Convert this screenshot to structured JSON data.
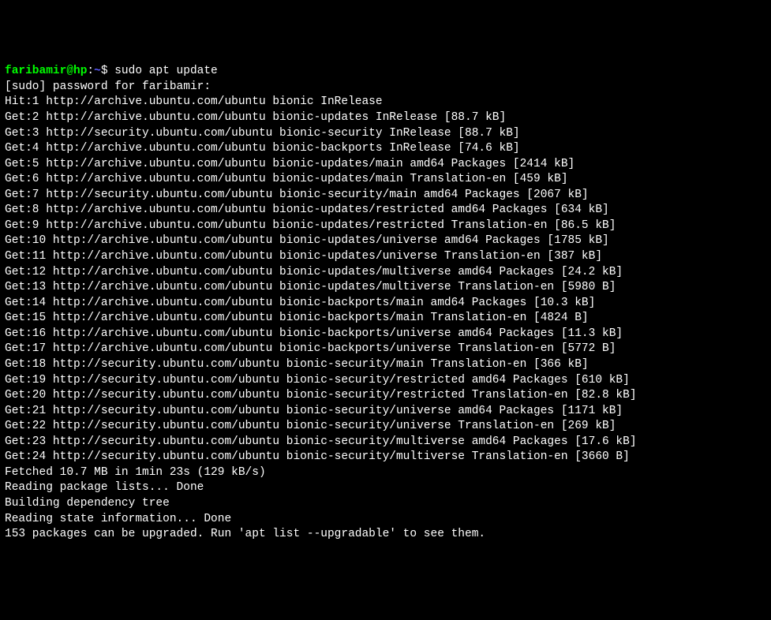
{
  "prompt": {
    "user_host": "faribamir@hp",
    "separator": ":",
    "path": "~",
    "dollar": "$ "
  },
  "command": "sudo apt update",
  "lines": [
    "[sudo] password for faribamir: ",
    "Hit:1 http://archive.ubuntu.com/ubuntu bionic InRelease",
    "Get:2 http://archive.ubuntu.com/ubuntu bionic-updates InRelease [88.7 kB]",
    "Get:3 http://security.ubuntu.com/ubuntu bionic-security InRelease [88.7 kB]",
    "Get:4 http://archive.ubuntu.com/ubuntu bionic-backports InRelease [74.6 kB]",
    "Get:5 http://archive.ubuntu.com/ubuntu bionic-updates/main amd64 Packages [2414 kB]",
    "Get:6 http://archive.ubuntu.com/ubuntu bionic-updates/main Translation-en [459 kB]",
    "Get:7 http://security.ubuntu.com/ubuntu bionic-security/main amd64 Packages [2067 kB]",
    "Get:8 http://archive.ubuntu.com/ubuntu bionic-updates/restricted amd64 Packages [634 kB]",
    "Get:9 http://archive.ubuntu.com/ubuntu bionic-updates/restricted Translation-en [86.5 kB]",
    "Get:10 http://archive.ubuntu.com/ubuntu bionic-updates/universe amd64 Packages [1785 kB]",
    "Get:11 http://archive.ubuntu.com/ubuntu bionic-updates/universe Translation-en [387 kB]",
    "Get:12 http://archive.ubuntu.com/ubuntu bionic-updates/multiverse amd64 Packages [24.2 kB]",
    "Get:13 http://archive.ubuntu.com/ubuntu bionic-updates/multiverse Translation-en [5980 B]",
    "Get:14 http://archive.ubuntu.com/ubuntu bionic-backports/main amd64 Packages [10.3 kB]",
    "Get:15 http://archive.ubuntu.com/ubuntu bionic-backports/main Translation-en [4824 B]",
    "Get:16 http://archive.ubuntu.com/ubuntu bionic-backports/universe amd64 Packages [11.3 kB]",
    "Get:17 http://archive.ubuntu.com/ubuntu bionic-backports/universe Translation-en [5772 B]",
    "Get:18 http://security.ubuntu.com/ubuntu bionic-security/main Translation-en [366 kB]",
    "Get:19 http://security.ubuntu.com/ubuntu bionic-security/restricted amd64 Packages [610 kB]",
    "Get:20 http://security.ubuntu.com/ubuntu bionic-security/restricted Translation-en [82.8 kB]",
    "Get:21 http://security.ubuntu.com/ubuntu bionic-security/universe amd64 Packages [1171 kB]",
    "Get:22 http://security.ubuntu.com/ubuntu bionic-security/universe Translation-en [269 kB]",
    "Get:23 http://security.ubuntu.com/ubuntu bionic-security/multiverse amd64 Packages [17.6 kB]",
    "Get:24 http://security.ubuntu.com/ubuntu bionic-security/multiverse Translation-en [3660 B]",
    "Fetched 10.7 MB in 1min 23s (129 kB/s)",
    "Reading package lists... Done",
    "Building dependency tree",
    "Reading state information... Done",
    "153 packages can be upgraded. Run 'apt list --upgradable' to see them."
  ]
}
